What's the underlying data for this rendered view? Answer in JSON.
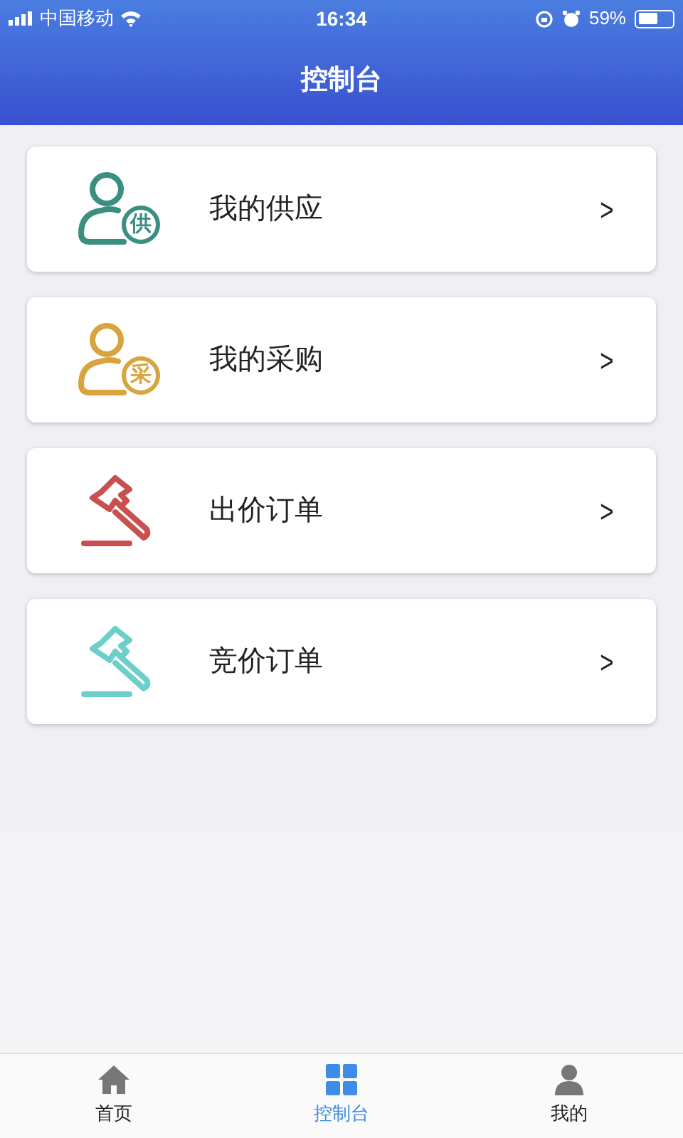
{
  "status_bar": {
    "carrier": "中国移动",
    "time": "16:34",
    "battery": "59%"
  },
  "header": {
    "title": "控制台"
  },
  "menu": [
    {
      "kind": "person",
      "color": "#3a8f80",
      "badge": "供",
      "label": "我的供应",
      "chevron": ">"
    },
    {
      "kind": "person",
      "color": "#d9a440",
      "badge": "采",
      "label": "我的采购",
      "chevron": ">"
    },
    {
      "kind": "gavel",
      "color": "#c9504e",
      "label": "出价订单",
      "chevron": ">"
    },
    {
      "kind": "gavel",
      "color": "#6ccfca",
      "label": "竞价订单",
      "chevron": ">"
    }
  ],
  "tab_bar": [
    {
      "kind": "home",
      "label": "首页",
      "selected": false
    },
    {
      "kind": "grid",
      "label": "控制台",
      "selected": true
    },
    {
      "kind": "person",
      "label": "我的",
      "selected": false
    }
  ]
}
